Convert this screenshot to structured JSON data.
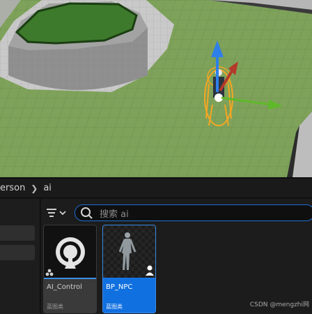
{
  "breadcrumb": {
    "items": [
      "erson",
      "ai"
    ]
  },
  "search": {
    "placeholder": "搜索 ai"
  },
  "assets": [
    {
      "name": "AI_Control",
      "type": "蓝图类",
      "icon": "ai-controller-icon",
      "selected": false
    },
    {
      "name": "BP_NPC",
      "type": "蓝图类",
      "icon": "character-mannequin-icon",
      "selected": true
    }
  ],
  "watermark": "CSDN @mengzhi网",
  "colors": {
    "accent": "#1774e6",
    "ground": "#7ea25a",
    "selection": "#f5a623"
  }
}
